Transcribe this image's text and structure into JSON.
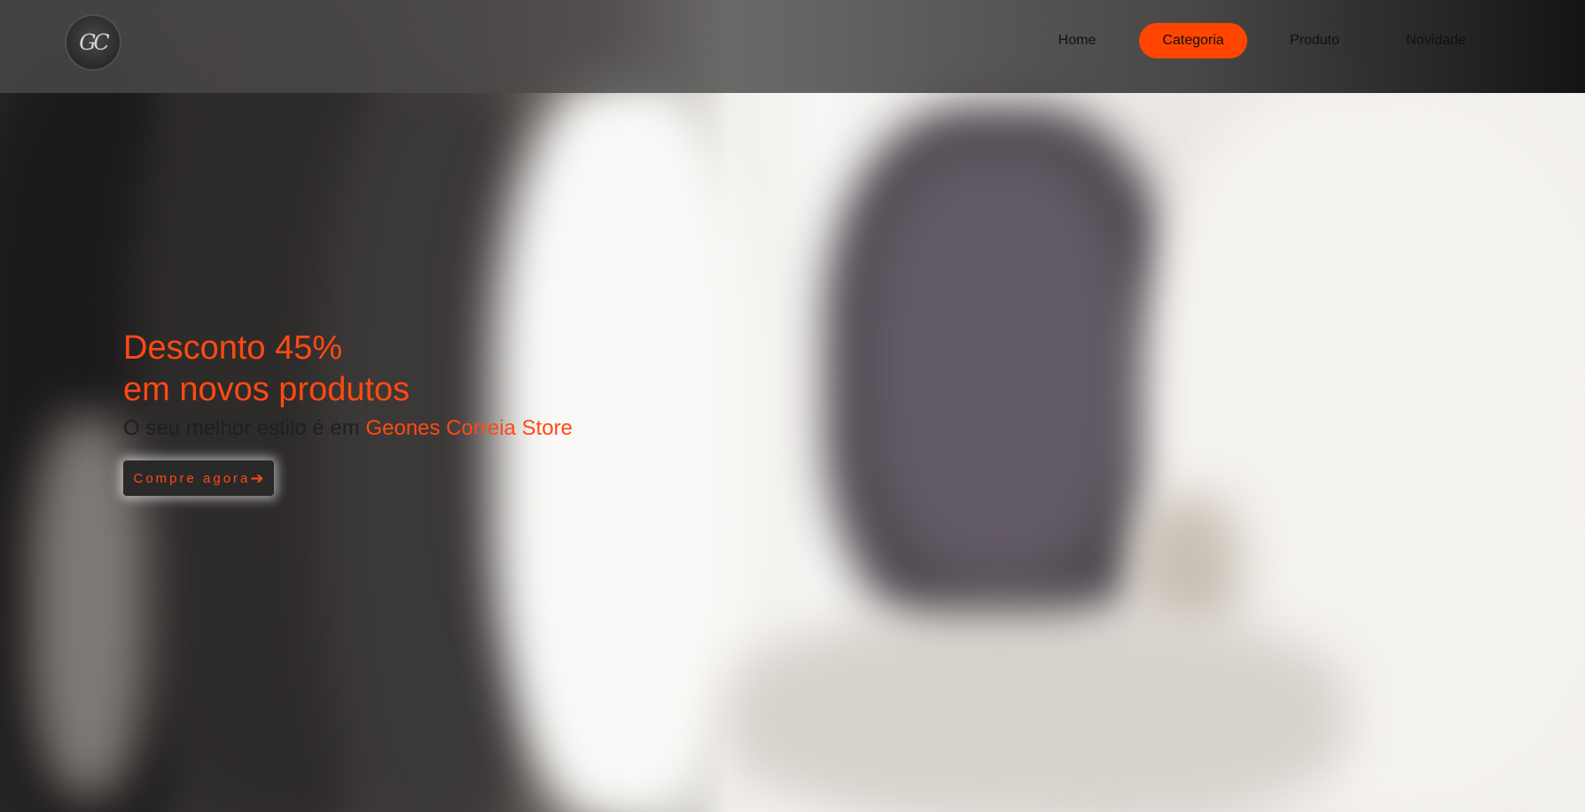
{
  "logo": {
    "initials": "GC"
  },
  "nav": {
    "items": [
      {
        "label": "Home",
        "active": false
      },
      {
        "label": "Categoria",
        "active": true
      },
      {
        "label": "Produto",
        "active": false
      },
      {
        "label": "Novidade",
        "active": false
      }
    ]
  },
  "hero": {
    "headline_line1": "Desconto 45%",
    "headline_line2": "em novos produtos",
    "tagline_prefix": "O seu melhor estilo é em ",
    "tagline_brand": "Geones Correia Store",
    "cta_label": "Compre agora",
    "cta_icon": "arrow-right-icon"
  },
  "colors": {
    "accent": "#ff4500",
    "cta_background": "#2a2929"
  }
}
